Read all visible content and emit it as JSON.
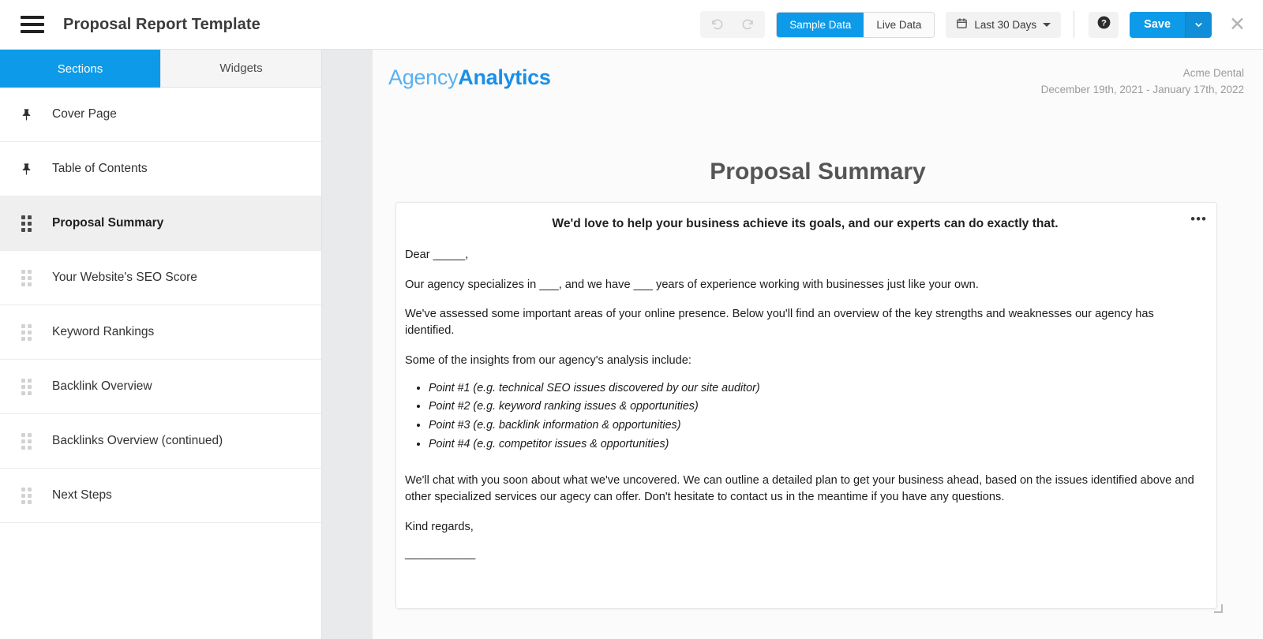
{
  "topbar": {
    "menu_icon": "hamburger-icon",
    "title": "Proposal Report Template",
    "undo_icon": "undo-icon",
    "redo_icon": "redo-icon",
    "data_toggle": {
      "active": "Sample Data",
      "inactive": "Live Data"
    },
    "date_range": {
      "icon": "calendar-icon",
      "label": "Last 30 Days"
    },
    "help_label": "?",
    "save_label": "Save",
    "save_caret_icon": "chevron-down-icon",
    "close_icon": "close-icon",
    "accent_color": "#0d9ae8"
  },
  "sidebar": {
    "tabs": [
      {
        "label": "Sections",
        "active": true
      },
      {
        "label": "Widgets",
        "active": false
      }
    ],
    "items": [
      {
        "label": "Cover Page",
        "handle": "pin-icon",
        "active": false
      },
      {
        "label": "Table of Contents",
        "handle": "pin-icon",
        "active": false
      },
      {
        "label": "Proposal Summary",
        "handle": "drag-handle-icon",
        "active": true
      },
      {
        "label": "Your Website's SEO Score",
        "handle": "drag-handle-icon",
        "active": false
      },
      {
        "label": "Keyword Rankings",
        "handle": "drag-handle-icon",
        "active": false
      },
      {
        "label": "Backlink Overview",
        "handle": "drag-handle-icon",
        "active": false
      },
      {
        "label": "Backlinks Overview (continued)",
        "handle": "drag-handle-icon",
        "active": false
      },
      {
        "label": "Next Steps",
        "handle": "drag-handle-icon",
        "active": false
      }
    ]
  },
  "report": {
    "logo": {
      "part1": "Agency",
      "part2": "Analytics",
      "color1": "#5ab0f0",
      "color2": "#1a8fe8"
    },
    "client_name": "Acme Dental",
    "date_range": "December 19th, 2021 - January 17th, 2022",
    "section_title": "Proposal Summary",
    "widget": {
      "menu_icon": "ellipsis-icon",
      "headline": "We'd love to help your business achieve its goals, and our experts can do exactly that.",
      "salutation": "Dear _____,",
      "paragraph1": "Our agency specializes in ___, and we have ___ years of experience working with businesses just like your own.",
      "paragraph2": "We've assessed some important areas of your online presence. Below you'll find an overview of the key strengths and weaknesses our agency has identified.",
      "paragraph3": "Some of the insights from our agency's analysis include:",
      "bullets": [
        "Point #1 (e.g. technical SEO issues discovered by our site auditor)",
        "Point #2 (e.g. keyword ranking issues & opportunities)",
        "Point #3 (e.g. backlink information & opportunities)",
        "Point #4 (e.g. competitor issues & opportunities)"
      ],
      "paragraph4": "We'll chat with you soon about what we've uncovered. We can outline a detailed plan to get your business ahead, based on the issues identified above and other specialized services our agecy can offer. Don't hesitate to contact us in the meantime if you have any questions.",
      "closing": "Kind regards,",
      "signature_line": "___________",
      "resize_handle": "resize-handle-icon"
    }
  }
}
